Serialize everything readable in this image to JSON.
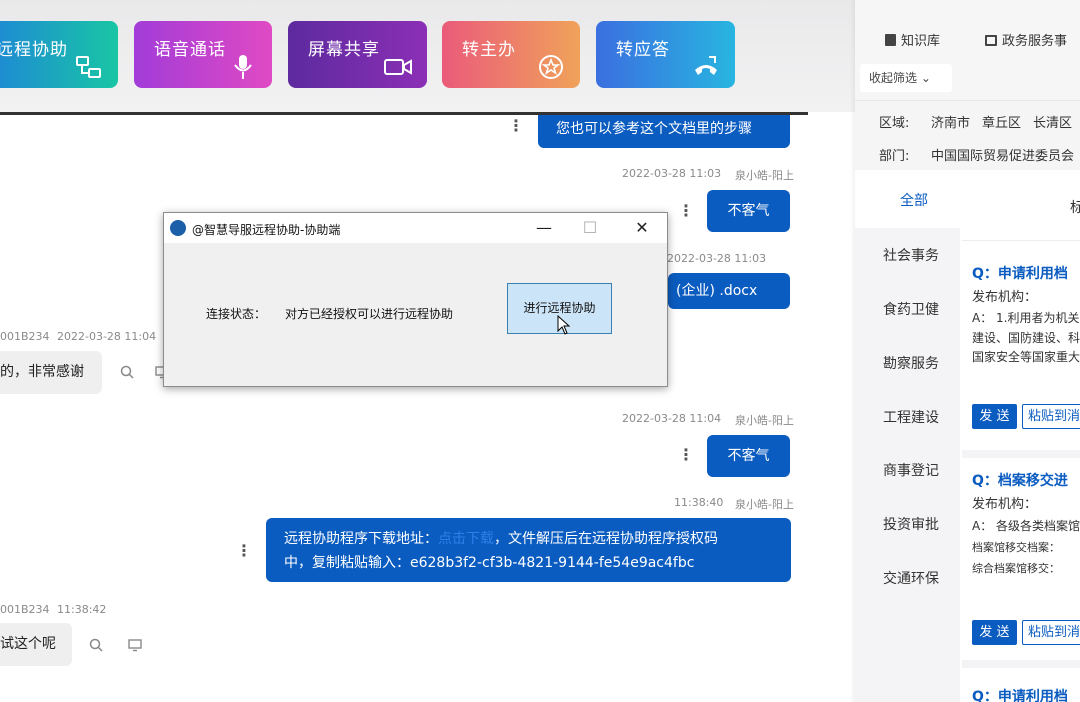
{
  "toolbar": {
    "actions": [
      {
        "label": "远程协助",
        "icon": "remote-assist-icon"
      },
      {
        "label": "语音通话",
        "icon": "microphone-icon"
      },
      {
        "label": "屏幕共享",
        "icon": "video-camera-icon"
      },
      {
        "label": "转主办",
        "icon": "star-circle-icon"
      },
      {
        "label": "转应答",
        "icon": "call-transfer-icon"
      }
    ]
  },
  "chat": {
    "messages": [
      {
        "side": "right",
        "text": "您也可以参考这个文档里的步骤"
      },
      {
        "side": "right",
        "meta_time": "2022-03-28 11:03",
        "meta_user": "泉小皓-阳上",
        "text": "不客气"
      },
      {
        "side": "right",
        "meta_time": "2022-03-28 11:03",
        "text": "(企业) .docx"
      },
      {
        "side": "left",
        "meta_user": "001B234",
        "meta_time": "2022-03-28 11:04",
        "text": "的，非常感谢"
      },
      {
        "side": "right",
        "meta_time": "2022-03-28 11:04",
        "meta_user": "泉小皓-阳上",
        "text": "不客气"
      },
      {
        "side": "right",
        "meta_time": "11:38:40",
        "meta_user": "泉小皓-阳上",
        "text_line1": "远程协助程序下载地址：",
        "link": "点击下载",
        "text_line1_after": "，文件解压后在远程协助程序授权码",
        "text_line2": "中，复制粘贴输入：e628b3f2-cf3b-4821-9144-fe54e9ac4fbc"
      },
      {
        "side": "left",
        "meta_user": "001B234",
        "meta_time": "11:38:42",
        "text": "试这个呢"
      }
    ]
  },
  "dialog": {
    "title": "@智慧导服远程协助-协助端",
    "minimize": "—",
    "maximize": "☐",
    "close": "✕",
    "status_label": "连接状态：",
    "status_value": "对方已经授权可以进行远程协助",
    "action_button": "进行远程协助"
  },
  "right_panel": {
    "top_links": [
      {
        "label": "知识库",
        "icon": "book-icon"
      },
      {
        "label": "政务服务事",
        "icon": "folder-icon"
      }
    ],
    "collapse_label": "收起筛选 ⌄",
    "region_label": "区域:",
    "regions": [
      "济南市",
      "章丘区",
      "长清区"
    ],
    "dept_label": "部门:",
    "dept_value": "中国国际贸易促进委员会",
    "tabs": [
      "全部",
      "标"
    ],
    "categories": [
      "社会事务",
      "食药卫健",
      "勘察服务",
      "工程建设",
      "商事登记",
      "投资审批",
      "交通环保"
    ],
    "cards": [
      {
        "title": "Q：申请利用档",
        "publisher_label": "发布机构：",
        "answer_lines": [
          "A：  1.利用者为机关",
          "建设、国防建设、科",
          "国家安全等国家重大"
        ],
        "send": "发 送",
        "paste": "粘贴到消"
      },
      {
        "title": "Q：档案移交进",
        "publisher_label": "发布机构：",
        "answer_lines": [
          "A：  各级各类档案馆",
          "档案馆移交档案：",
          "综合档案馆移交："
        ],
        "send": "发 送",
        "paste": "粘贴到消"
      },
      {
        "title": "Q：申请利用档"
      }
    ]
  }
}
